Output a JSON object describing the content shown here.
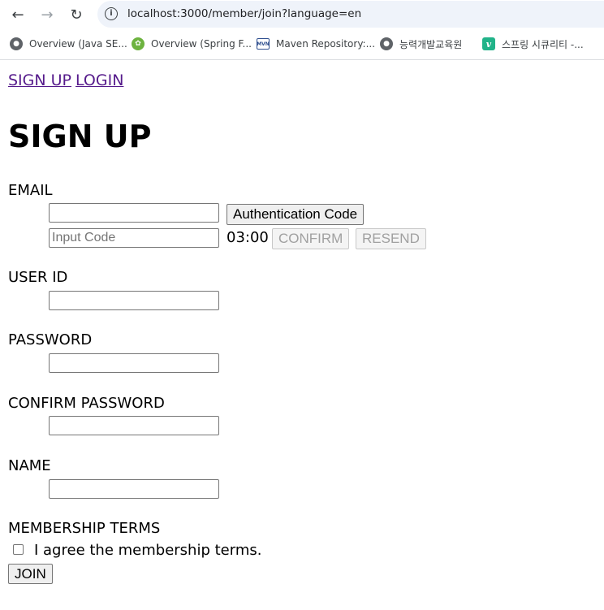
{
  "browser": {
    "url": "localhost:3000/member/join?language=en",
    "bookmarks": [
      {
        "label": "Overview (Java SE...",
        "icon": "globe-icon"
      },
      {
        "label": "Overview (Spring F...",
        "icon": "spring-icon"
      },
      {
        "label": "Maven Repository:...",
        "icon": "maven-icon"
      },
      {
        "label": "능력개발교육원",
        "icon": "globe-icon"
      },
      {
        "label": "스프링 시큐리티 -...",
        "icon": "v-icon"
      }
    ]
  },
  "page": {
    "links": {
      "signup": "SIGN UP",
      "login": "LOGIN"
    },
    "title": "SIGN UP",
    "email": {
      "label": "EMAIL",
      "value": "",
      "auth_button": "Authentication Code",
      "code_placeholder": "Input Code",
      "timer": "03:00",
      "confirm_button": "CONFIRM",
      "resend_button": "RESEND"
    },
    "user_id": {
      "label": "USER ID",
      "value": ""
    },
    "password": {
      "label": "PASSWORD",
      "value": ""
    },
    "confirm_password": {
      "label": "CONFIRM PASSWORD",
      "value": ""
    },
    "name": {
      "label": "NAME",
      "value": ""
    },
    "terms": {
      "label": "MEMBERSHIP TERMS",
      "agree_text": "I agree the membership terms.",
      "checked": false
    },
    "join_button": "JOIN"
  }
}
